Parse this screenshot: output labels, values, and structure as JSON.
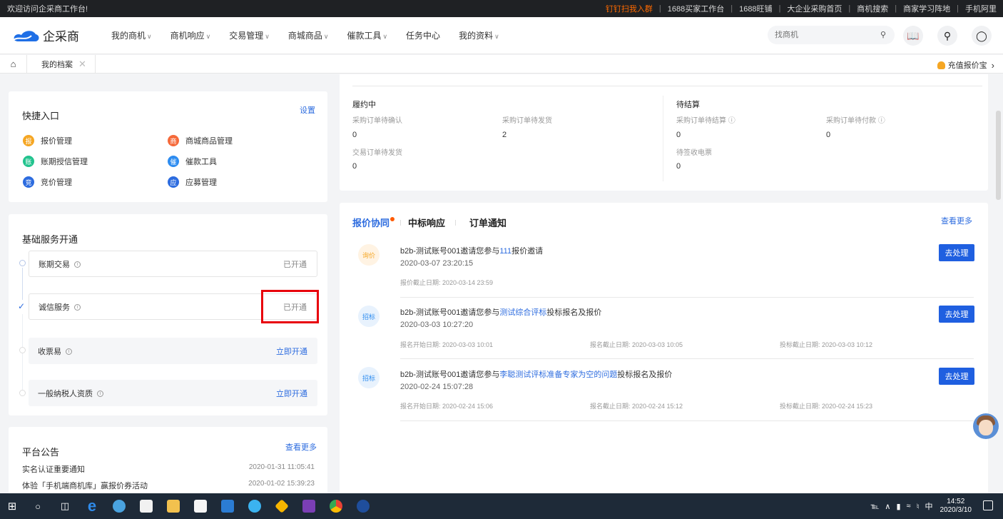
{
  "topbar": {
    "welcome": "欢迎访问企采商工作台!",
    "links": [
      "钉钉扫我入群",
      "1688买家工作台",
      "1688旺铺",
      "大企业采购首页",
      "商机搜索",
      "商家学习阵地",
      "手机阿里"
    ]
  },
  "nav": {
    "logo_text": "企采商",
    "menu": [
      {
        "label": "我的商机",
        "caret": "∨"
      },
      {
        "label": "商机响应",
        "caret": "∨"
      },
      {
        "label": "交易管理",
        "caret": "∨"
      },
      {
        "label": "商城商品",
        "caret": "∨"
      },
      {
        "label": "催款工具",
        "caret": "∨"
      },
      {
        "label": "任务中心",
        "caret": ""
      },
      {
        "label": "我的资料",
        "caret": "∨"
      }
    ],
    "search_placeholder": "找商机"
  },
  "tabbar": {
    "tab_label": "我的档案",
    "recharge_label": "充值报价宝"
  },
  "quick": {
    "title": "快捷入口",
    "settings": "设置",
    "items": [
      {
        "badge": "报",
        "label": "报价管理",
        "color": "#f5a623"
      },
      {
        "badge": "商",
        "label": "商城商品管理",
        "color": "#f56a3b"
      },
      {
        "badge": "账",
        "label": "账期授信管理",
        "color": "#22c38e"
      },
      {
        "badge": "催",
        "label": "催款工具",
        "color": "#2d8cf0"
      },
      {
        "badge": "竞",
        "label": "竞价管理",
        "color": "#2d6cdf"
      },
      {
        "badge": "应",
        "label": "应募管理",
        "color": "#2d6cdf"
      }
    ]
  },
  "basic": {
    "title": "基础服务开通",
    "services": [
      {
        "label": "账期交易",
        "status": "已开通"
      },
      {
        "label": "诚信服务",
        "status": "已开通"
      },
      {
        "label": "收票易",
        "status": "立即开通"
      },
      {
        "label": "一般纳税人资质",
        "status": "立即开通"
      }
    ]
  },
  "notice": {
    "title": "平台公告",
    "more": "查看更多",
    "items": [
      {
        "title": "实名认证重要通知",
        "time": "2020-01-31 11:05:41"
      },
      {
        "title": "体验「手机端商机库」赢报价券活动",
        "time": "2020-01-02 15:39:23"
      }
    ]
  },
  "orders": {
    "left_title": "履约中",
    "right_title": "待结算",
    "cells": [
      {
        "label": "采购订单待确认",
        "value": "0"
      },
      {
        "label": "采购订单待发货",
        "value": "2"
      },
      {
        "label": "交易订单待发货",
        "value": "0"
      },
      {
        "label": "采购订单待结算",
        "value": "0"
      },
      {
        "label": "采购订单待付款",
        "value": "0"
      },
      {
        "label": "待签收电票",
        "value": "0"
      }
    ]
  },
  "feed": {
    "tabs": [
      "报价协同",
      "中标响应",
      "订单通知"
    ],
    "more": "查看更多",
    "action": "去处理",
    "items": [
      {
        "badge": "询价",
        "prefix": "b2b-测试账号001邀请您参与",
        "highlight": "111",
        "suffix": "报价邀请",
        "time": "2020-03-07 23:20:15",
        "meta": [
          "报价截止日期: 2020-03-14 23:59"
        ]
      },
      {
        "badge": "招标",
        "prefix": "b2b-测试账号001邀请您参与",
        "highlight": "测试综合评标",
        "suffix": "投标报名及报价",
        "time": "2020-03-03 10:27:20",
        "meta": [
          "报名开始日期: 2020-03-03 10:01",
          "报名截止日期: 2020-03-03 10:05",
          "投标截止日期: 2020-03-03 10:12"
        ]
      },
      {
        "badge": "招标",
        "prefix": "b2b-测试账号001邀请您参与",
        "highlight": "李聪测试评标准备专家为空的问题",
        "suffix": "投标报名及报价",
        "time": "2020-02-24 15:07:28",
        "meta": [
          "报名开始日期: 2020-02-24 15:06",
          "报名截止日期: 2020-02-24 15:12",
          "投标截止日期: 2020-02-24 15:23"
        ]
      }
    ]
  },
  "taskbar": {
    "ime": "中",
    "time": "14:52",
    "date": "2020/3/10"
  }
}
